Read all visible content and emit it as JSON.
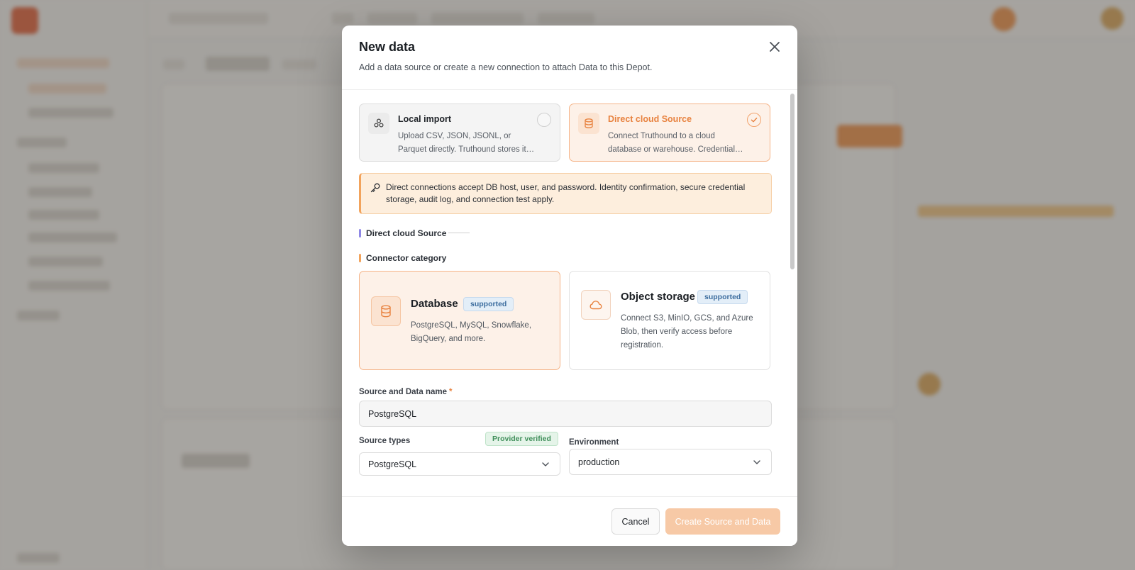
{
  "modal": {
    "title": "New data",
    "subtitle": "Add a data source or create a new connection to attach Data to this Depot."
  },
  "import_options": [
    {
      "title": "Local import",
      "description": "Upload CSV, JSON, JSONL, or Parquet directly. Truthound stores it…",
      "icon": "cluster-icon",
      "selected": false
    },
    {
      "title": "Direct cloud Source",
      "description": "Connect Truthound to a cloud database or warehouse. Credential…",
      "icon": "database-icon",
      "selected": true
    }
  ],
  "notice": {
    "icon": "key-icon",
    "text": "Direct connections accept DB host, user, and password. Identity confirmation, secure credential storage, audit log, and connection test apply."
  },
  "section_direct": "Direct cloud Source",
  "section_connector": "Connector category",
  "connector_categories": [
    {
      "title": "Database",
      "badge": "supported",
      "description": "PostgreSQL, MySQL, Snowflake, BigQuery, and more.",
      "icon": "database-icon",
      "selected": true
    },
    {
      "title": "Object storage",
      "badge": "supported",
      "description": "Connect S3, MinIO, GCS, and Azure Blob, then verify access before registration.",
      "icon": "cloud-icon",
      "selected": false
    }
  ],
  "form": {
    "name_label": "Source and Data name",
    "name_required": "*",
    "name_value": "PostgreSQL",
    "source_types_label": "Source types",
    "source_types_badge": "Provider verified",
    "source_types_value": "PostgreSQL",
    "environment_label": "Environment",
    "environment_value": "production"
  },
  "footer": {
    "cancel": "Cancel",
    "create": "Create Source and Data"
  },
  "colors": {
    "accent": "#e8823f",
    "accent_bg": "#fdf1e8",
    "notice_bg": "#fdeedd",
    "badge_bg": "#e3eef8",
    "verified_bg": "#e5f4e9",
    "overlay": "#5a5650"
  }
}
